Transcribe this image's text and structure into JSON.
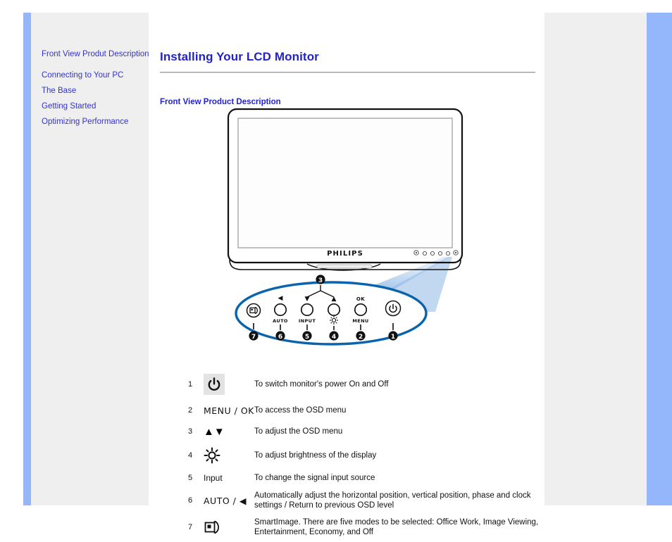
{
  "theme": {
    "rail_blue": "#94b6fa",
    "panel_gray": "#efefef",
    "link_blue": "#3333cc",
    "heading_blue": "#2222cc",
    "callout_blue": "#0a63ad",
    "cone_blue": "#7aa9e0"
  },
  "sidebar": {
    "items": [
      {
        "label": "Front View Produt Description"
      },
      {
        "label": "Connecting to Your PC"
      },
      {
        "label": "The Base"
      },
      {
        "label": "Getting Started"
      },
      {
        "label": "Optimizing Performance"
      }
    ]
  },
  "content": {
    "page_title": "Installing Your LCD Monitor",
    "section_heading": "Front View Product Description"
  },
  "illustration": {
    "brand_logo": "PHILIPS",
    "callout_numbers": [
      "1",
      "2",
      "3",
      "4",
      "5",
      "6",
      "7"
    ],
    "button_labels": {
      "power": "power-symbol",
      "menu": "MENU",
      "ok": "OK",
      "brightness": "brightness-symbol",
      "input": "INPUT",
      "auto": "AUTO",
      "smartimage": "smartimage-symbol"
    },
    "up_arrow": "▲",
    "down_arrow": "▼",
    "left_arrow": "◀"
  },
  "legend": {
    "rows": [
      {
        "num": "1",
        "icon_name": "power-icon",
        "icon_text": "⏻",
        "desc": "To switch monitor's power On and Off"
      },
      {
        "num": "2",
        "icon_name": "menu-ok-icon",
        "icon_text": "MENU / OK",
        "desc": "To access the OSD menu"
      },
      {
        "num": "3",
        "icon_name": "up-down-arrows-icon",
        "icon_text": "▲▼",
        "desc": "To adjust the OSD menu"
      },
      {
        "num": "4",
        "icon_name": "brightness-icon",
        "icon_text": "brightness-sun",
        "desc": "To adjust brightness of the display"
      },
      {
        "num": "5",
        "icon_name": "input-label-icon",
        "icon_text": "Input",
        "desc": "To change the signal input source"
      },
      {
        "num": "6",
        "icon_name": "auto-left-icon",
        "icon_text": "AUTO / ◀",
        "desc": "Automatically adjust the horizontal position, vertical position, phase and clock settings / Return to previous OSD level"
      },
      {
        "num": "7",
        "icon_name": "smartimage-icon",
        "icon_text": "smartimage-glyph",
        "desc": "SmartImage. There are five modes to be selected: Office Work, Image Viewing, Entertainment, Economy, and Off"
      }
    ]
  }
}
